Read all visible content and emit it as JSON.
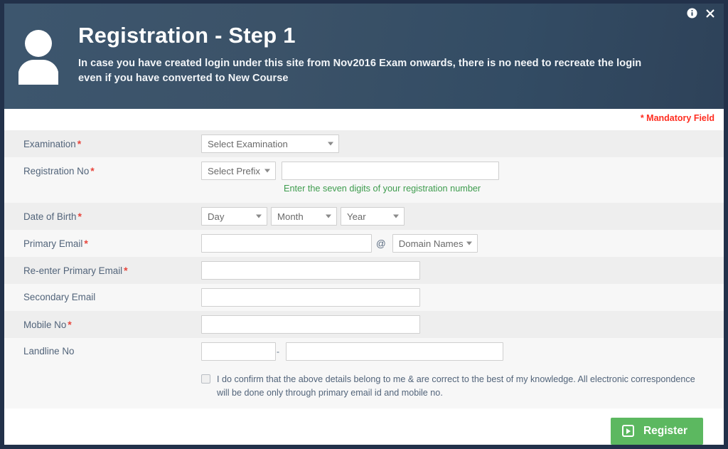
{
  "window": {
    "info_icon": "info-icon",
    "close_icon": "close-icon"
  },
  "header": {
    "avatar_icon": "user-avatar-icon",
    "title": "Registration - Step 1",
    "subtitle_line1": "In case you have created login under this site from Nov2016 Exam onwards, there is no need to recreate the login",
    "subtitle_line2": "even if you have converted to New Course",
    "background_color": "#3b5268"
  },
  "mandatory_note": "* Mandatory Field",
  "mandatory_color": "#ff2d20",
  "form": {
    "examination": {
      "label": "Examination",
      "required": true,
      "select_value": "Select Examination"
    },
    "registration_no": {
      "label": "Registration No",
      "required": true,
      "prefix_value": "Select Prefix",
      "number_value": "",
      "hint": "Enter the seven digits of your registration number",
      "hint_color": "#3e9c4e"
    },
    "date_of_birth": {
      "label": "Date of Birth",
      "required": true,
      "day_value": "Day",
      "month_value": "Month",
      "year_value": "Year"
    },
    "primary_email": {
      "label": "Primary Email",
      "required": true,
      "value": "",
      "at_symbol": "@",
      "domain_value": "Domain Names"
    },
    "reenter_primary_email": {
      "label": "Re-enter Primary Email",
      "required": true,
      "value": ""
    },
    "secondary_email": {
      "label": "Secondary Email",
      "required": false,
      "value": ""
    },
    "mobile_no": {
      "label": "Mobile No",
      "required": true,
      "value": ""
    },
    "landline_no": {
      "label": "Landline No",
      "required": false,
      "code_value": "",
      "number_value": "",
      "separator": "-"
    }
  },
  "declaration": {
    "checked": false,
    "text": "I do confirm that the above details belong to me & are correct to the best of my knowledge. All electronic correspondence will be done only through primary email id and mobile no."
  },
  "footer": {
    "register_label": "Register",
    "register_color": "#5cb860",
    "register_icon": "play-box-icon"
  }
}
